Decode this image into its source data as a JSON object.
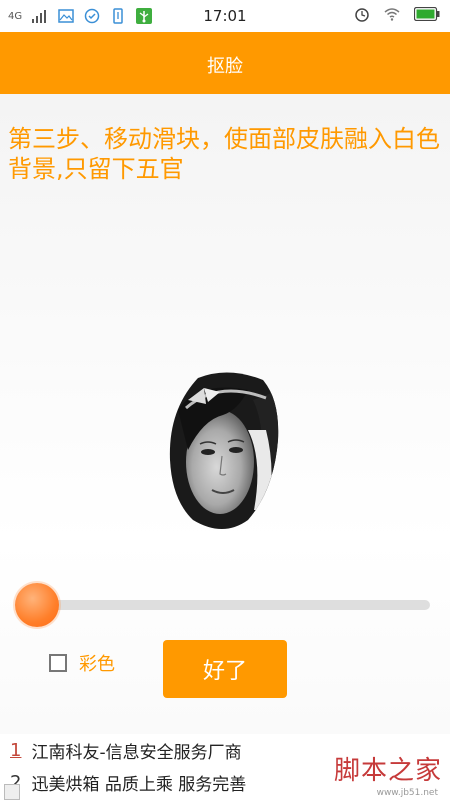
{
  "status_bar": {
    "network": "4G",
    "time": "17:01"
  },
  "header": {
    "title": "抠脸"
  },
  "main": {
    "instruction": "第三步、移动滑块，使面部皮肤融入白色背景,只留下五官",
    "slider": {
      "value_fraction": 0.0
    },
    "color_checkbox": {
      "label": "彩色",
      "checked": false
    },
    "ok_button": {
      "label": "好了"
    }
  },
  "ads": {
    "items": [
      {
        "num": "1",
        "text": "江南科友-信息安全服务厂商"
      },
      {
        "num": "2",
        "text": "迅美烘箱 品质上乘 服务完善"
      }
    ],
    "watermark": "脚本之家",
    "watermark_url": "www.jb51.net"
  },
  "colors": {
    "accent": "#ff9900",
    "slider_thumb": "#ff7f2a"
  }
}
